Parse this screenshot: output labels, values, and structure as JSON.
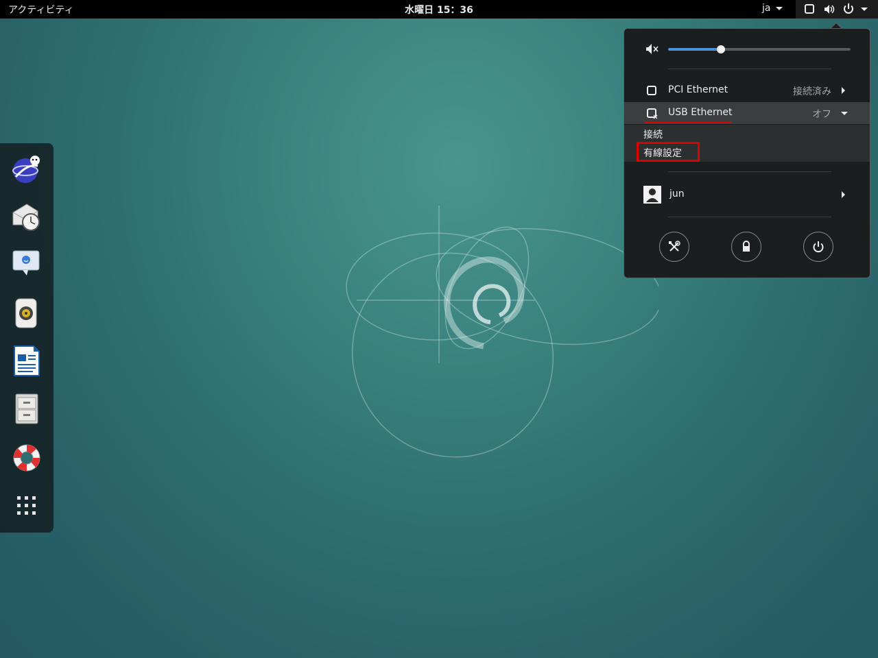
{
  "topbar": {
    "activities": "アクティビティ",
    "clock": "水曜日 15：36",
    "lang": "ja"
  },
  "dock": {
    "apps": [
      "web-browser-icon",
      "mail-clock-icon",
      "chat-icon",
      "speaker-icon",
      "writer-document-icon",
      "file-cabinet-icon",
      "lifebuoy-help-icon",
      "show-apps-grid-icon"
    ]
  },
  "menu": {
    "volume_level": 0.29,
    "pci_ethernet": {
      "label": "PCI Ethernet",
      "status": "接続済み"
    },
    "usb_ethernet": {
      "label": "USB Ethernet",
      "status": "オフ"
    },
    "submenu": {
      "connect": "接続",
      "wired_settings": "有線設定"
    },
    "user": "jun"
  },
  "colors": {
    "highlight": "#e00000",
    "slider_fill": "#4a90d9"
  }
}
